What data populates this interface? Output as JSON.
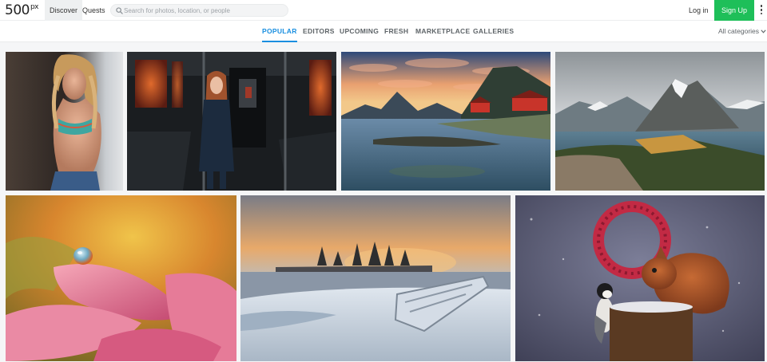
{
  "brand": {
    "logo": "500",
    "logo_sup": "px"
  },
  "nav": {
    "discover": "Discover",
    "quests": "Quests"
  },
  "search": {
    "placeholder": "Search for photos, location, or people"
  },
  "auth": {
    "login": "Log in",
    "signup": "Sign Up"
  },
  "tabs": [
    "POPULAR",
    "EDITORS",
    "UPCOMING",
    "FRESH",
    "MARKETPLACE",
    "GALLERIES"
  ],
  "active_tab": "POPULAR",
  "category_filter": "All categories",
  "colors": {
    "accent": "#1a8fe0",
    "signup_green": "#1ebf59"
  },
  "photos": [
    {
      "subject": "woman-portrait-braids"
    },
    {
      "subject": "woman-in-train-car"
    },
    {
      "subject": "lofoten-red-cabins-sunset"
    },
    {
      "subject": "mountain-lake-overlook"
    },
    {
      "subject": "water-drop-on-petal"
    },
    {
      "subject": "frozen-shore-boat-sunrise"
    },
    {
      "subject": "squirrel-berry-wreath-bird"
    }
  ]
}
